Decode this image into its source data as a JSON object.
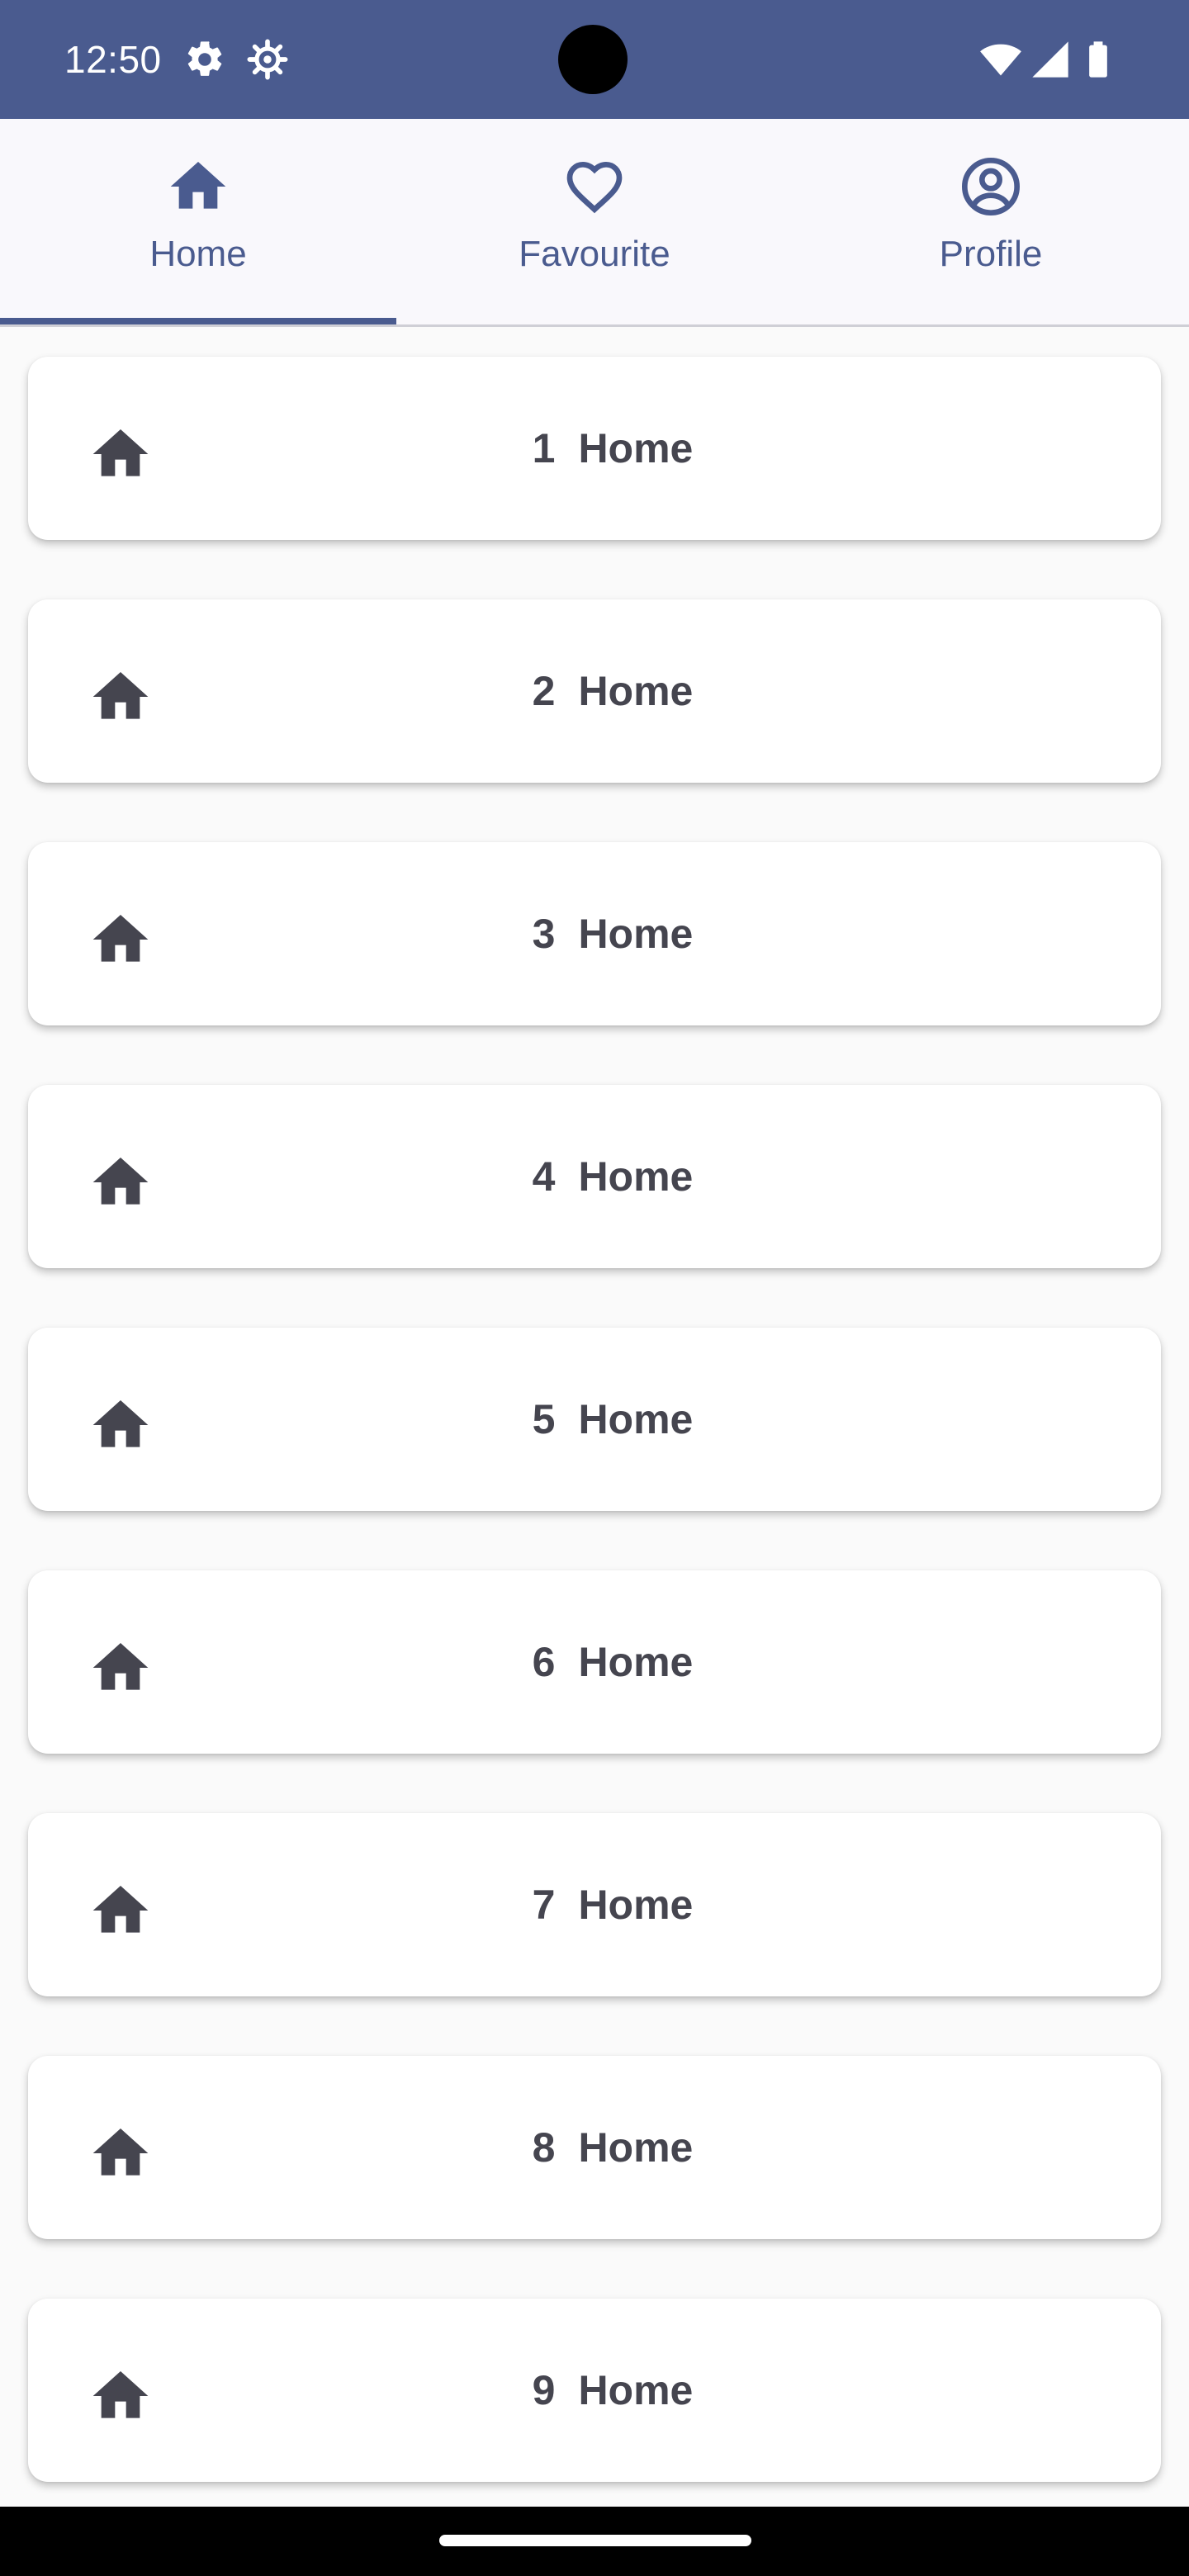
{
  "status_bar": {
    "time": "12:50",
    "left_icons": [
      "gear-icon",
      "bug-gear-icon"
    ],
    "right_icons": [
      "wifi-icon",
      "signal-icon",
      "battery-icon"
    ],
    "background": "#4a5b8f"
  },
  "tabs": [
    {
      "label": "Home",
      "icon": "home-icon",
      "selected": true
    },
    {
      "label": "Favourite",
      "icon": "heart-outline-icon",
      "selected": false
    },
    {
      "label": "Profile",
      "icon": "account-circle-icon",
      "selected": false
    }
  ],
  "list": {
    "items": [
      {
        "number": "1",
        "label": "Home",
        "icon": "home-icon"
      },
      {
        "number": "2",
        "label": "Home",
        "icon": "home-icon"
      },
      {
        "number": "3",
        "label": "Home",
        "icon": "home-icon"
      },
      {
        "number": "4",
        "label": "Home",
        "icon": "home-icon"
      },
      {
        "number": "5",
        "label": "Home",
        "icon": "home-icon"
      },
      {
        "number": "6",
        "label": "Home",
        "icon": "home-icon"
      },
      {
        "number": "7",
        "label": "Home",
        "icon": "home-icon"
      },
      {
        "number": "8",
        "label": "Home",
        "icon": "home-icon"
      },
      {
        "number": "9",
        "label": "Home",
        "icon": "home-icon"
      }
    ]
  },
  "colors": {
    "accent": "#4a5b8f",
    "card_text": "#45454f",
    "card_background": "#ffffff",
    "page_background": "#fafafa"
  }
}
